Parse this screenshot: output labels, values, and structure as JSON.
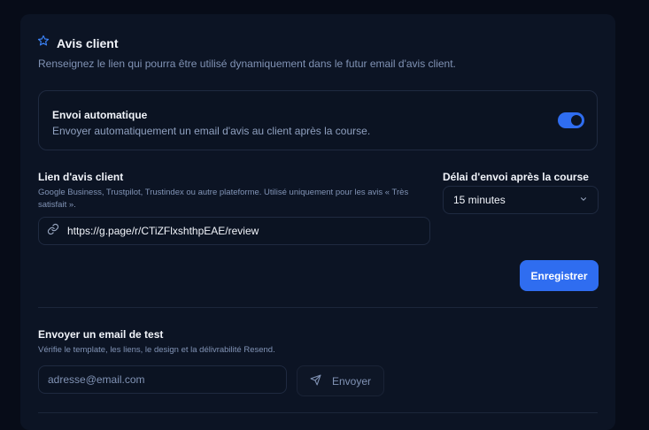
{
  "section": {
    "title": "Avis client",
    "subtitle": "Renseignez le lien qui pourra être utilisé dynamiquement dans le futur email d'avis client.",
    "icon": "star-icon"
  },
  "auto_send": {
    "title": "Envoi automatique",
    "description": "Envoyer automatiquement un email d'avis au client après la course.",
    "enabled": true
  },
  "review_link": {
    "label": "Lien d'avis client",
    "help": "Google Business, Trustpilot, Trustindex ou autre plateforme. Utilisé uniquement pour les avis « Très satisfait ».",
    "value": "https://g.page/r/CTiZFlxshthpEAE/review",
    "icon": "link-icon"
  },
  "delay": {
    "label": "Délai d'envoi après la course",
    "selected": "15 minutes"
  },
  "save_label": "Enregistrer",
  "test_email": {
    "label": "Envoyer un email de test",
    "help": "Vérifie le template, les liens, le design et la délivrabilité Resend.",
    "placeholder": "adresse@email.com",
    "send_label": "Envoyer"
  },
  "colors": {
    "accent": "#2f6df0",
    "background": "#070c18",
    "card": "#0c1424"
  }
}
